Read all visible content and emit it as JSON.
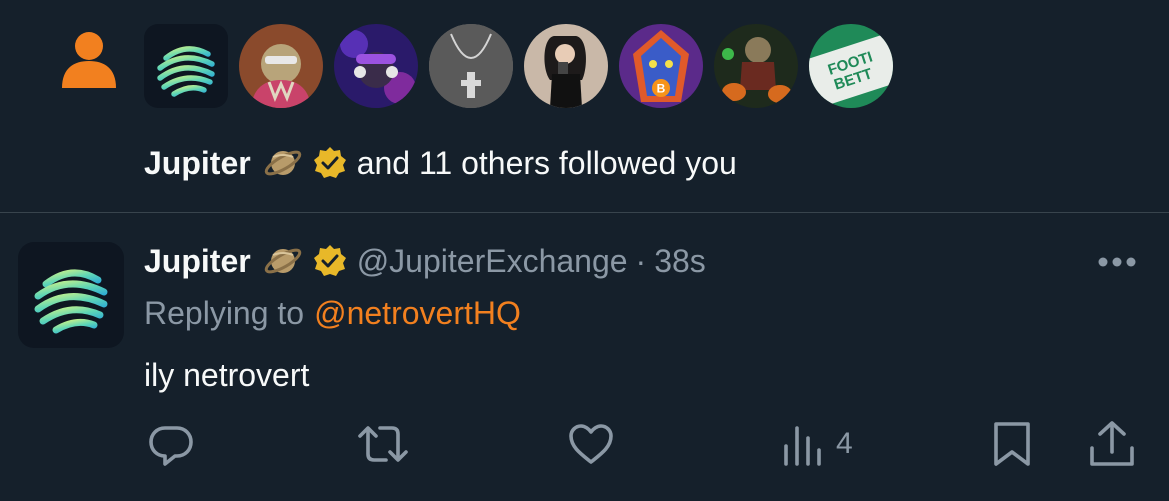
{
  "colors": {
    "background": "#15202b",
    "text_primary": "#f7f9f9",
    "text_secondary": "#8b98a5",
    "accent_orange": "#f2801f",
    "verified_gold": "#e8b829",
    "divider": "#38444d"
  },
  "follow_notification": {
    "icon": "person-icon",
    "avatars": [
      "jupiter-logo-avatar",
      "ape-avatar",
      "dj-ape-avatar",
      "necklace-avatar",
      "girl-avatar",
      "bitcoin-mask-avatar",
      "pumpkin-avatar",
      "football-avatar"
    ],
    "avatar_text": {
      "football": [
        "FOOTI",
        "BETT"
      ]
    },
    "name": "Jupiter",
    "name_emoji": "saturn-icon",
    "badge": "verified-badge-icon",
    "message": "and 11 others followed you"
  },
  "tweet": {
    "display_name": "Jupiter",
    "name_emoji": "saturn-icon",
    "badge": "verified-badge-icon",
    "handle": "@JupiterExchange",
    "separator": "·",
    "timestamp": "38s",
    "replying_to_label": "Replying to",
    "replying_to_handle": "@netrovertHQ",
    "text": "ily netrovert",
    "actions": {
      "reply": "reply-icon",
      "retweet": "retweet-icon",
      "like": "like-icon",
      "views": "views-icon",
      "views_count": "4",
      "bookmark": "bookmark-icon",
      "share": "share-icon"
    }
  }
}
